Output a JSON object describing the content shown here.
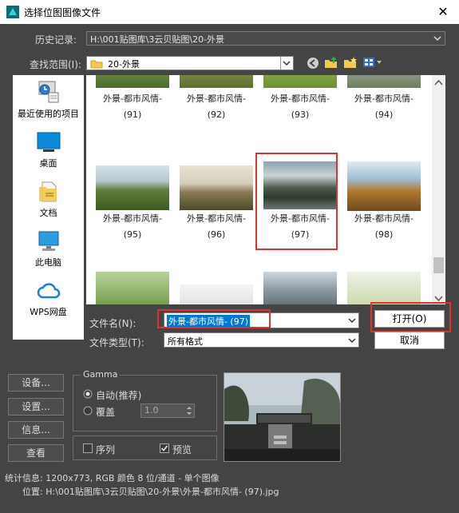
{
  "window": {
    "title": "选择位图图像文件"
  },
  "history": {
    "label": "历史记录:",
    "value": "H:\\001贴图库\\3云贝贴图\\20-外景"
  },
  "lookin": {
    "label": "查找范围(I):",
    "value": "20-外景"
  },
  "places": [
    {
      "label": "最近使用的项目",
      "icon": "recent-items-icon"
    },
    {
      "label": "桌面",
      "icon": "desktop-icon"
    },
    {
      "label": "文档",
      "icon": "documents-icon"
    },
    {
      "label": "此电脑",
      "icon": "computer-icon"
    },
    {
      "label": "WPS网盘",
      "icon": "wps-cloud-icon"
    }
  ],
  "files": [
    {
      "line1": "外景-都市风情-",
      "line2": "(91)"
    },
    {
      "line1": "外景-都市风情-",
      "line2": "(92)"
    },
    {
      "line1": "外景-都市风情-",
      "line2": "(93)"
    },
    {
      "line1": "外景-都市风情-",
      "line2": "(94)"
    },
    {
      "line1": "外景-都市风情-",
      "line2": "(95)"
    },
    {
      "line1": "外景-都市风情-",
      "line2": "(96)"
    },
    {
      "line1": "外景-都市风情-",
      "line2": "(97)"
    },
    {
      "line1": "外景-都市风情-",
      "line2": "(98)"
    }
  ],
  "filename": {
    "label": "文件名(N):",
    "value": "外景-都市风情- (97)"
  },
  "filetype": {
    "label": "文件类型(T):",
    "value": "所有格式"
  },
  "buttons": {
    "open": "打开(O)",
    "cancel": "取消",
    "setup": "设备...",
    "settings": "设置...",
    "info": "信息...",
    "view": "查看"
  },
  "gamma": {
    "title": "Gamma",
    "auto": "自动(推荐)",
    "override": "覆盖",
    "override_value": "1.0"
  },
  "options": {
    "sequence": "序列",
    "preview": "预览"
  },
  "stats": {
    "label": "统计信息:",
    "value": "1200x773, RGB 颜色 8 位/通道 - 单个图像"
  },
  "location": {
    "label": "位置:",
    "value": "H:\\001贴图库\\3云贝贴图\\20-外景\\外景-都市风情- (97).jpg"
  },
  "colors": {
    "accent_red": "#e0312f",
    "selection_blue": "#0078d7",
    "dialog_bg": "#444444"
  }
}
